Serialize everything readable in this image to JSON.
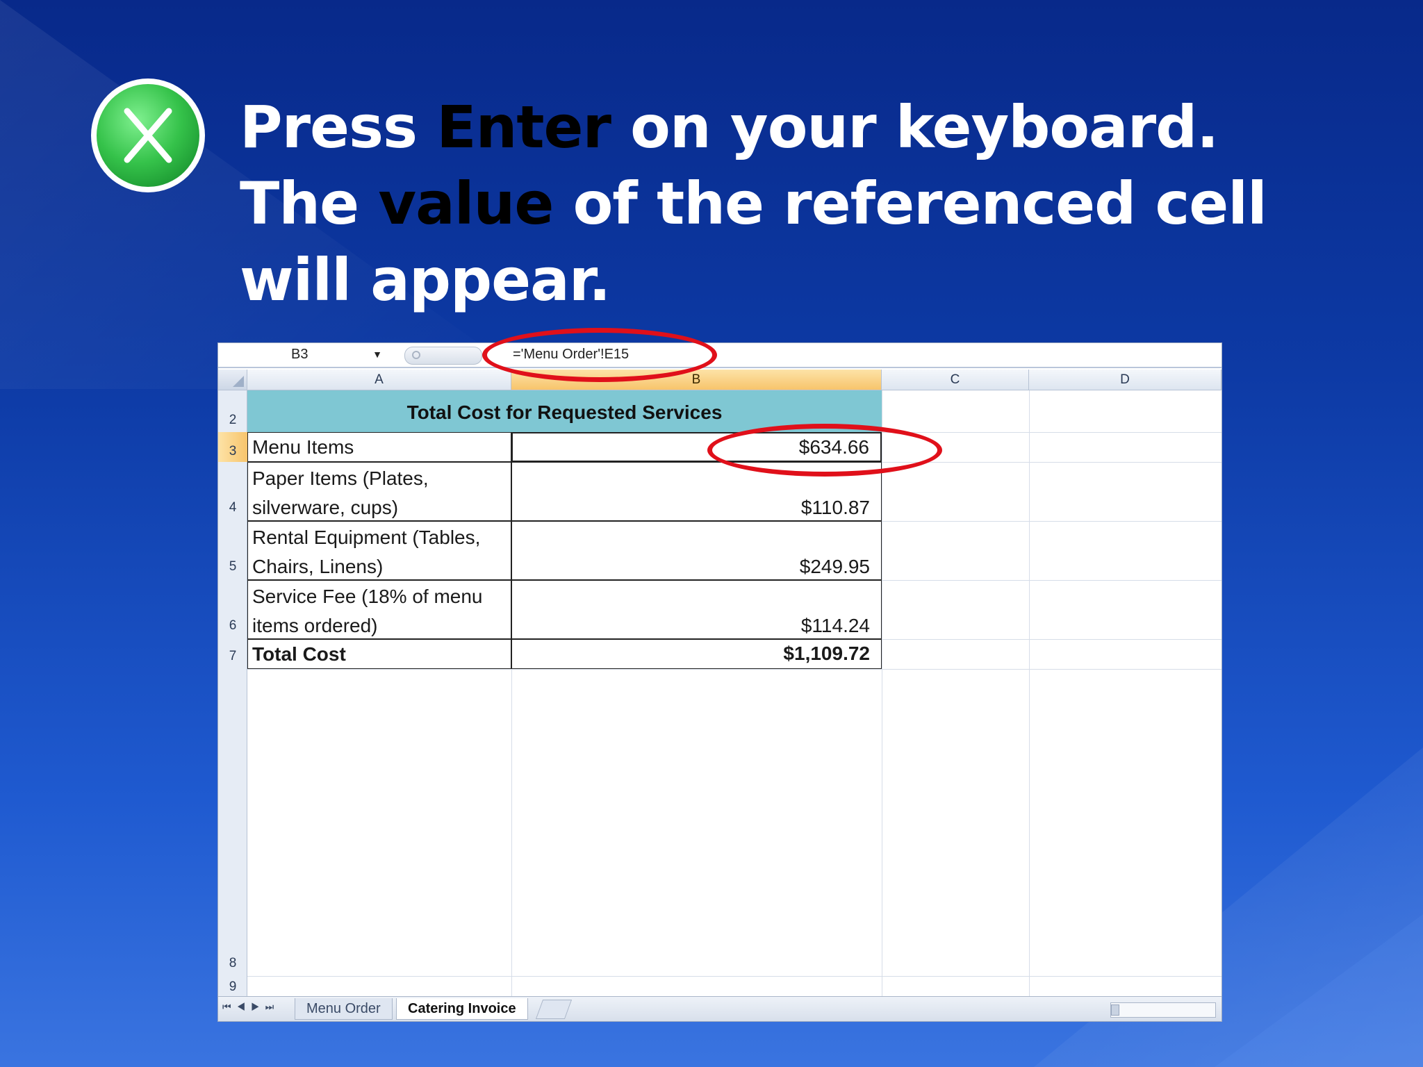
{
  "slide": {
    "heading_line1_part1": "Press ",
    "heading_line1_emph": "Enter",
    "heading_line1_part2": " on your keyboard.",
    "heading_line2_part1": "The ",
    "heading_line2_emph": "value",
    "heading_line2_part2": " of the referenced cell will appear.",
    "logo_icon": "excel-x-icon",
    "colors": {
      "background": "#0d3aa5",
      "emphasis": "#000000",
      "heading": "#ffffff",
      "annotation": "#e0101a",
      "logo": "#4cd964"
    }
  },
  "spreadsheet": {
    "name_box": "B3",
    "formula": "='Menu Order'!E15",
    "columns": [
      "A",
      "B",
      "C",
      "D"
    ],
    "active_column": "B",
    "active_row": "3",
    "row_numbers": [
      "2",
      "3",
      "4",
      "5",
      "6",
      "7",
      "8",
      "9"
    ],
    "title": "Total Cost for Requested Services",
    "rows": [
      {
        "label": "Menu Items",
        "value": "$634.66"
      },
      {
        "label": "Paper Items (Plates, silverware, cups)",
        "value": "$110.87"
      },
      {
        "label": "Rental Equipment (Tables, Chairs, Linens)",
        "value": "$249.95"
      },
      {
        "label": "Service Fee (18% of menu items ordered)",
        "value": "$114.24"
      },
      {
        "label": "Total Cost",
        "value": "$1,109.72"
      }
    ],
    "sheet_tabs": [
      "Menu Order",
      "Catering Invoice"
    ],
    "active_tab": "Catering Invoice"
  }
}
